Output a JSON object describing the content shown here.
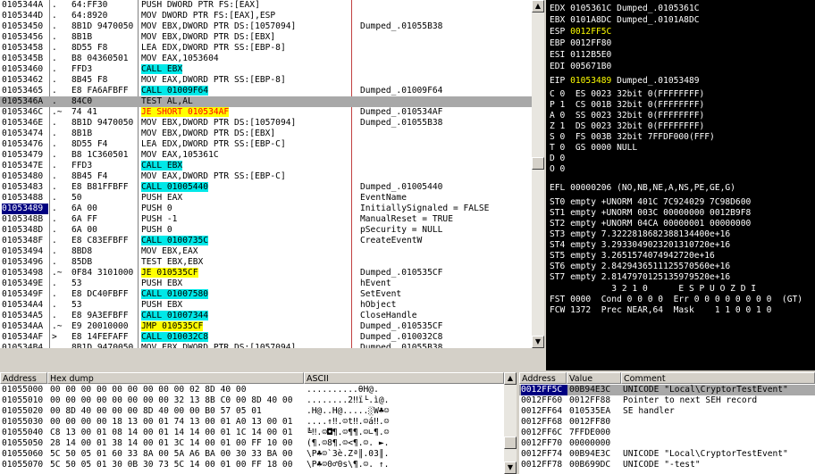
{
  "disasm": [
    {
      "addr": "0105344A",
      "mark": ".",
      "hex": "64:FF30",
      "asm": "PUSH DWORD PTR FS:[EAX]",
      "cmt": "",
      "style": ""
    },
    {
      "addr": "0105344D",
      "mark": ".",
      "hex": "64:8920",
      "asm": "MOV DWORD PTR FS:[EAX],ESP",
      "cmt": "",
      "style": ""
    },
    {
      "addr": "01053450",
      "mark": ".",
      "hex": "8B1D 9470050",
      "asm": "MOV EBX,DWORD PTR DS:[1057094]",
      "cmt": "Dumped_.01055B38",
      "style": ""
    },
    {
      "addr": "01053456",
      "mark": ".",
      "hex": "8B1B",
      "asm": "MOV EBX,DWORD PTR DS:[EBX]",
      "cmt": "",
      "style": ""
    },
    {
      "addr": "01053458",
      "mark": ".",
      "hex": "8D55 F8",
      "asm": "LEA EDX,DWORD PTR SS:[EBP-8]",
      "cmt": "",
      "style": ""
    },
    {
      "addr": "0105345B",
      "mark": ".",
      "hex": "B8 04360501",
      "asm": "MOV EAX,1053604",
      "cmt": "",
      "style": ""
    },
    {
      "addr": "01053460",
      "mark": ".",
      "hex": "FFD3",
      "asm": "CALL EBX",
      "cmt": "",
      "style": "call"
    },
    {
      "addr": "01053462",
      "mark": ".",
      "hex": "8B45 F8",
      "asm": "MOV EAX,DWORD PTR SS:[EBP-8]",
      "cmt": "",
      "style": ""
    },
    {
      "addr": "01053465",
      "mark": ".",
      "hex": "E8 FA6AFBFF",
      "asm": "CALL 01009F64",
      "cmt": "Dumped_.01009F64",
      "style": "call"
    },
    {
      "addr": "0105346A",
      "mark": ".",
      "hex": "84C0",
      "asm": "TEST AL,AL",
      "cmt": "",
      "style": "sel"
    },
    {
      "addr": "0105346C",
      "mark": ".~",
      "hex": "74 41",
      "asm": "JE SHORT 010534AF",
      "cmt": "Dumped_.010534AF",
      "style": "jred"
    },
    {
      "addr": "0105346E",
      "mark": ".",
      "hex": "8B1D 9470050",
      "asm": "MOV EBX,DWORD PTR DS:[1057094]",
      "cmt": "Dumped_.01055B38",
      "style": ""
    },
    {
      "addr": "01053474",
      "mark": ".",
      "hex": "8B1B",
      "asm": "MOV EBX,DWORD PTR DS:[EBX]",
      "cmt": "",
      "style": ""
    },
    {
      "addr": "01053476",
      "mark": ".",
      "hex": "8D55 F4",
      "asm": "LEA EDX,DWORD PTR SS:[EBP-C]",
      "cmt": "",
      "style": ""
    },
    {
      "addr": "01053479",
      "mark": ".",
      "hex": "B8 1C360501",
      "asm": "MOV EAX,105361C",
      "cmt": "",
      "style": ""
    },
    {
      "addr": "0105347E",
      "mark": ".",
      "hex": "FFD3",
      "asm": "CALL EBX",
      "cmt": "",
      "style": "call"
    },
    {
      "addr": "01053480",
      "mark": ".",
      "hex": "8B45 F4",
      "asm": "MOV EAX,DWORD PTR SS:[EBP-C]",
      "cmt": "",
      "style": ""
    },
    {
      "addr": "01053483",
      "mark": ".",
      "hex": "E8 B81FFBFF",
      "asm": "CALL 01005440",
      "cmt": "Dumped_.01005440",
      "style": "call"
    },
    {
      "addr": "01053488",
      "mark": ".",
      "hex": "50",
      "asm": "PUSH EAX",
      "cmt": "EventName",
      "style": ""
    },
    {
      "addr": "01053489",
      "mark": ".",
      "hex": "6A 00",
      "asm": "PUSH 0",
      "cmt": "InitiallySignaled = FALSE",
      "style": "eip"
    },
    {
      "addr": "0105348B",
      "mark": ".",
      "hex": "6A FF",
      "asm": "PUSH -1",
      "cmt": "ManualReset = TRUE",
      "style": ""
    },
    {
      "addr": "0105348D",
      "mark": ".",
      "hex": "6A 00",
      "asm": "PUSH 0",
      "cmt": "pSecurity = NULL",
      "style": ""
    },
    {
      "addr": "0105348F",
      "mark": ".",
      "hex": "E8 C83EFBFF",
      "asm": "CALL 0100735C",
      "cmt": "CreateEventW",
      "style": "call"
    },
    {
      "addr": "01053494",
      "mark": ".",
      "hex": "8BD8",
      "asm": "MOV EBX,EAX",
      "cmt": "",
      "style": ""
    },
    {
      "addr": "01053496",
      "mark": ".",
      "hex": "85DB",
      "asm": "TEST EBX,EBX",
      "cmt": "",
      "style": ""
    },
    {
      "addr": "01053498",
      "mark": ".~",
      "hex": "0F84 3101000",
      "asm": "JE 010535CF",
      "cmt": "Dumped_.010535CF",
      "style": "jmp"
    },
    {
      "addr": "0105349E",
      "mark": ".",
      "hex": "53",
      "asm": "PUSH EBX",
      "cmt": "hEvent",
      "style": ""
    },
    {
      "addr": "0105349F",
      "mark": ".",
      "hex": "E8 DC40FBFF",
      "asm": "CALL 01007580",
      "cmt": "SetEvent",
      "style": "call"
    },
    {
      "addr": "010534A4",
      "mark": ".",
      "hex": "53",
      "asm": "PUSH EBX",
      "cmt": "hObject",
      "style": ""
    },
    {
      "addr": "010534A5",
      "mark": ".",
      "hex": "E8 9A3EFBFF",
      "asm": "CALL 01007344",
      "cmt": "CloseHandle",
      "style": "call"
    },
    {
      "addr": "010534AA",
      "mark": ".~",
      "hex": "E9 20010000",
      "asm": "JMP 010535CF",
      "cmt": "Dumped_.010535CF",
      "style": "jmp"
    },
    {
      "addr": "010534AF",
      "mark": ">",
      "hex": "E8 14FEFAFF",
      "asm": "CALL 010032C8",
      "cmt": "Dumped_.010032C8",
      "style": "call"
    },
    {
      "addr": "010534B4",
      "mark": ".",
      "hex": "8B1D 9470050",
      "asm": "MOV EBX,DWORD PTR DS:[1057094]",
      "cmt": "Dumped_.01055B38",
      "style": ""
    }
  ],
  "registers": {
    "edx": "EDX 0105361C Dumped_.0105361C",
    "ebx": "EBX 0101A8DC Dumped_.0101A8DC",
    "esp_name": "ESP ",
    "esp_val": "0012FF5C",
    "ebp": "EBP 0012FF80",
    "esi": "ESI 0112B5E0",
    "edi": "EDI 005671B0",
    "eip_name": "EIP ",
    "eip_val": "01053489",
    "eip_rest": " Dumped_.01053489",
    "flags": [
      "C 0  ES 0023 32bit 0(FFFFFFFF)",
      "P 1  CS 001B 32bit 0(FFFFFFFF)",
      "A 0  SS 0023 32bit 0(FFFFFFFF)",
      "Z 1  DS 0023 32bit 0(FFFFFFFF)",
      "S 0  FS 003B 32bit 7FFDF000(FFF)",
      "T 0  GS 0000 NULL",
      "D 0",
      "O 0"
    ],
    "efl": "EFL 00000206 (NO,NB,NE,A,NS,PE,GE,G)",
    "st": [
      "ST0 empty +UNORM 401C 7C924029 7C98D600",
      "ST1 empty +UNORM 003C 00000000 0012B9F8",
      "ST2 empty +UNORM 04CA 00000001 00000000",
      "ST3 empty 7.3222818682388134400e+16",
      "ST4 empty 3.2933049023201310720e+16",
      "ST5 empty 3.2651574074942720e+16",
      "ST6 empty 2.8429436511125570560e+16",
      "ST7 empty 2.8147970125135979520e+16"
    ],
    "fpu_hdr": "            3 2 1 0      E S P U O Z D I",
    "fst": "FST 0000  Cond 0 0 0 0  Err 0 0 0 0 0 0 0 0  (GT)",
    "fcw": "FCW 1372  Prec NEAR,64  Mask    1 1 0 0 1 0"
  },
  "dump": {
    "headers": {
      "address": "Address",
      "hex": "Hex dump",
      "ascii": "ASCII"
    },
    "rows": [
      {
        "a": "01055000",
        "h": "00 00 00 00 00 00 00 00 00 02 8D 40 00",
        "s": "..........θH@."
      },
      {
        "a": "01055010",
        "h": "00 00 00 00 00 00 00 00 32 13 8B C0 00 8D 40 00",
        "s": "........2‼ï└.ì@."
      },
      {
        "a": "01055020",
        "h": "00 8D 40 00 00 00 8D 40 00 00 B0 57 05 01",
        "s": ".H@..H@.....░W♣☺"
      },
      {
        "a": "01055030",
        "h": "00 00 00 00 18 13 00 01 74 13 00 01 A0 13 00 01",
        "s": "....↑‼.☺t‼.☺á‼.☺"
      },
      {
        "a": "01055040",
        "h": "C8 13 00 01 08 14 00 01 14 14 00 01 1C 14 00 01",
        "s": "╚‼.☺◘¶.☺¶¶.☺∟¶.☺"
      },
      {
        "a": "01055050",
        "h": "28 14 00 01 38 14 00 01 3C 14 00 01 00 FF 10 00",
        "s": "(¶.☺8¶.☺<¶.☺. ►."
      },
      {
        "a": "01055060",
        "h": "5C 50 05 01 60 33 8A 00 5A A6 BA 00 30 33 BA 00",
        "s": "\\P♣☺`3è.Zª║.03║."
      },
      {
        "a": "01055070",
        "h": "5C 50 05 01 30 0B 30 73 5C 14 00 01 00 FF 18 00",
        "s": "\\P♣☺0♂0s\\¶.☺. ↑."
      }
    ]
  },
  "stack": {
    "headers": {
      "address": "Address",
      "value": "Value",
      "comment": "Comment"
    },
    "rows": [
      {
        "a": "0012FF5C",
        "v": "00B94E3C",
        "c": "UNICODE \"Local\\CryptorTestEvent\"",
        "sel": true
      },
      {
        "a": "0012FF60",
        "v": "0012FF88",
        "c": "Pointer to next SEH record",
        "sel": false
      },
      {
        "a": "0012FF64",
        "v": "010535EA",
        "c": "SE handler",
        "sel": false
      },
      {
        "a": "0012FF68",
        "v": "0012FF80",
        "c": "",
        "sel": false
      },
      {
        "a": "0012FF6C",
        "v": "7FFDE000",
        "c": "",
        "sel": false
      },
      {
        "a": "0012FF70",
        "v": "00000000",
        "c": "",
        "sel": false
      },
      {
        "a": "0012FF74",
        "v": "00B94E3C",
        "c": "UNICODE \"Local\\CryptorTestEvent\"",
        "sel": false
      },
      {
        "a": "0012FF78",
        "v": "00B699DC",
        "c": "UNICODE \"-test\"",
        "sel": false
      }
    ]
  }
}
